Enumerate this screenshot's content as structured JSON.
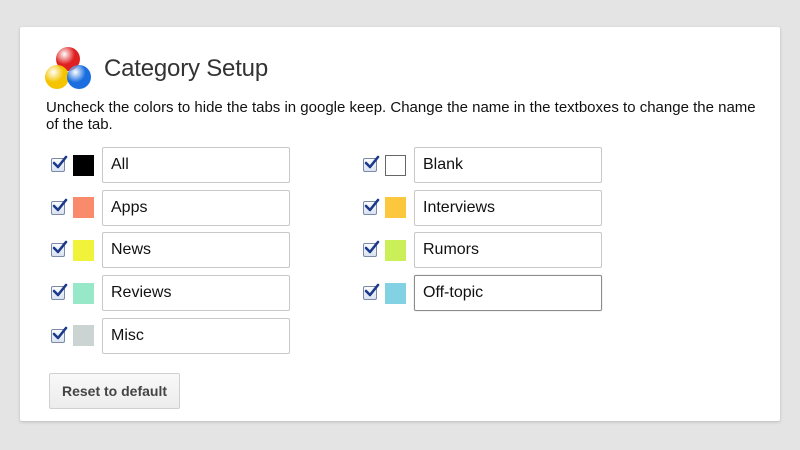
{
  "header": {
    "title": "Category Setup",
    "logo_colors": [
      "#e02020",
      "#f5c400",
      "#1a6ee0"
    ]
  },
  "description": "Uncheck the colors to hide the tabs in google keep. Change the name in the textboxes to change the name of the tab.",
  "categories_left": [
    {
      "label": "All",
      "color": "#000000",
      "checked": true
    },
    {
      "label": "Apps",
      "color": "#fa8a6c",
      "checked": true
    },
    {
      "label": "News",
      "color": "#f1f33b",
      "checked": true
    },
    {
      "label": "Reviews",
      "color": "#96e8c8",
      "checked": true
    },
    {
      "label": "Misc",
      "color": "#ccd3d3",
      "checked": true
    }
  ],
  "categories_right": [
    {
      "label": "Blank",
      "color": "#ffffff",
      "checked": true
    },
    {
      "label": "Interviews",
      "color": "#fcc63d",
      "checked": true
    },
    {
      "label": "Rumors",
      "color": "#cbef58",
      "checked": true
    },
    {
      "label": "Off-topic",
      "color": "#83d2e4",
      "checked": true,
      "focused": true
    }
  ],
  "buttons": {
    "reset_label": "Reset to default"
  }
}
